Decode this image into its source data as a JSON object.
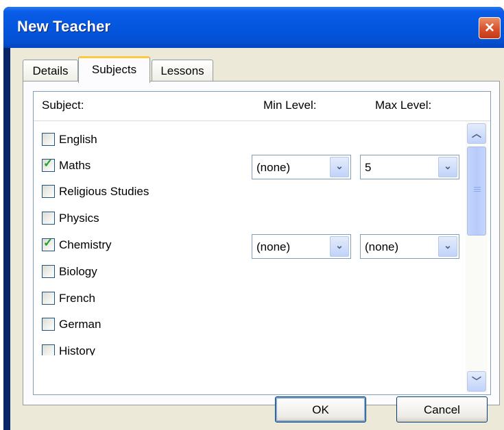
{
  "window": {
    "title": "New Teacher",
    "close_icon": "×"
  },
  "tabs": [
    {
      "label": "Details",
      "active": false
    },
    {
      "label": "Subjects",
      "active": true
    },
    {
      "label": "Lessons",
      "active": false
    }
  ],
  "columns": {
    "subject": "Subject:",
    "min_level": "Min Level:",
    "max_level": "Max Level:"
  },
  "subjects": [
    {
      "name": "English",
      "checked": false
    },
    {
      "name": "Maths",
      "checked": true,
      "min_level": "(none)",
      "max_level": "5"
    },
    {
      "name": "Religious Studies",
      "checked": false
    },
    {
      "name": "Physics",
      "checked": false
    },
    {
      "name": "Chemistry",
      "checked": true,
      "min_level": "(none)",
      "max_level": "(none)"
    },
    {
      "name": "Biology",
      "checked": false
    },
    {
      "name": "French",
      "checked": false
    },
    {
      "name": "German",
      "checked": false
    },
    {
      "name": "History",
      "checked": false
    }
  ],
  "glyphs": {
    "check": "✓",
    "dropdown": "⌄",
    "scroll_up": "︿",
    "scroll_down": "﹀"
  },
  "buttons": {
    "ok": "OK",
    "cancel": "Cancel"
  }
}
